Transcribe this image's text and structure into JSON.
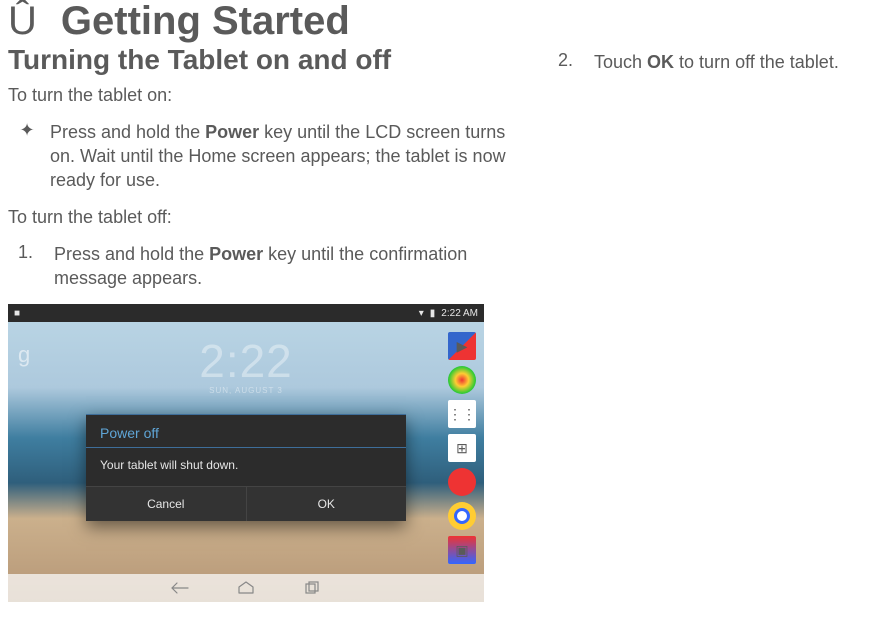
{
  "chapter": {
    "icon": "Û",
    "title": "Getting Started"
  },
  "left": {
    "heading": "Turning the Tablet on and off",
    "on_intro": "To turn the tablet on:",
    "on_bullet_pre": "Press and hold the ",
    "on_bullet_bold": "Power",
    "on_bullet_post": " key until the LCD screen turns on. Wait until the Home screen appears; the tablet is now ready for use.",
    "off_intro": "To turn the tablet off:",
    "off_step1_num": "1.",
    "off_step1_pre": "Press and hold the ",
    "off_step1_bold": "Power",
    "off_step1_post": " key until the confirmation message appears."
  },
  "right": {
    "step2_num": "2.",
    "step2_pre": "Touch ",
    "step2_bold": "OK",
    "step2_post": " to turn off the tablet."
  },
  "screenshot": {
    "status": {
      "left_glyph": "■",
      "wifi": "▾",
      "battery": "▮",
      "time": "2:22 AM"
    },
    "g_glyph": "g",
    "clock": {
      "time": "2:22",
      "sub": "SUN, AUGUST 3"
    },
    "dialog": {
      "title": "Power off",
      "body": "Your tablet will shut down.",
      "cancel": "Cancel",
      "ok": "OK"
    }
  }
}
